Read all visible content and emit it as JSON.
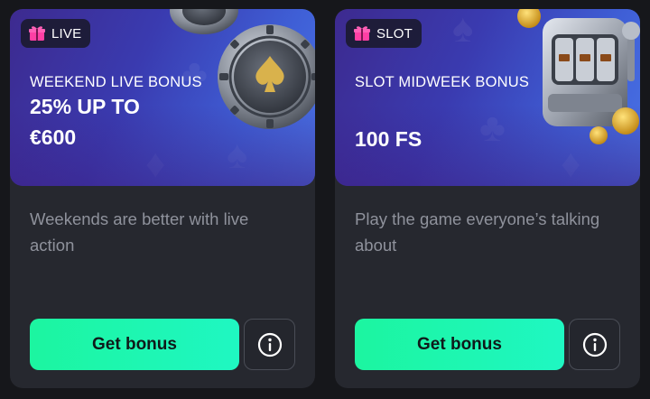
{
  "cards": [
    {
      "tag": "LIVE",
      "title": "WEEKEND LIVE BONUS",
      "amount_lines": [
        "25% UP TO",
        "€600"
      ],
      "description": "Weekends are better with live action",
      "cta_label": "Get bonus",
      "art": "poker-chips",
      "tag_icon": "gift-icon",
      "info_icon": "info-icon"
    },
    {
      "tag": "SLOT",
      "title": "SLOT MIDWEEK BONUS",
      "amount_lines": [
        "100 FS"
      ],
      "description": "Play the game everyone’s talking about",
      "cta_label": "Get bonus",
      "art": "slot-machine",
      "tag_icon": "gift-icon",
      "info_icon": "info-icon"
    }
  ],
  "colors": {
    "page_bg": "#16171b",
    "card_bg": "#26282f",
    "banner_start": "#3d2a8f",
    "banner_end": "#4a73e6",
    "cta_green": "#1cf5a0",
    "gift_pink": "#ff3fa4",
    "description_text": "#8f929c"
  }
}
